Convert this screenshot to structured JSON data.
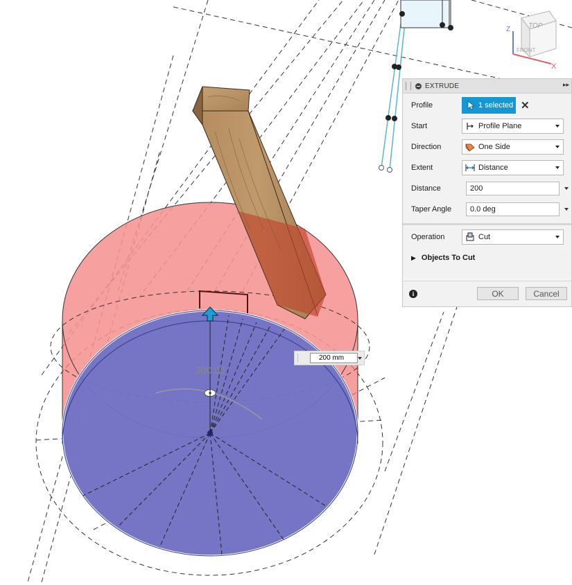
{
  "extrude_panel": {
    "title": "EXTRUDE",
    "profile": {
      "label": "Profile",
      "value": "1 selected"
    },
    "start": {
      "label": "Start",
      "value": "Profile Plane",
      "icon": "profile-plane-icon"
    },
    "direction": {
      "label": "Direction",
      "value": "One Side",
      "icon": "one-side-icon"
    },
    "extent": {
      "label": "Extent",
      "value": "Distance",
      "icon": "distance-icon"
    },
    "distance": {
      "label": "Distance",
      "value": "200"
    },
    "taper_angle": {
      "label": "Taper Angle",
      "value": "0.0 deg"
    },
    "operation": {
      "label": "Operation",
      "value": "Cut",
      "icon": "cut-icon"
    },
    "objects_to_cut": {
      "label": "Objects To Cut"
    },
    "ok_label": "OK",
    "cancel_label": "Cancel"
  },
  "viewport": {
    "dimension_input": "200 mm",
    "dimension_value": "200.00",
    "viewcube": {
      "top_label": "TOP",
      "front_label": "FRONT",
      "x_axis": "X",
      "z_axis": "Z"
    }
  },
  "colors": {
    "accent": "#1696d2",
    "cut_body": "#f47a7a",
    "profile_face": "#6f72c6",
    "wood": "#a8825a",
    "sketch_line": "#5ab4d6"
  }
}
